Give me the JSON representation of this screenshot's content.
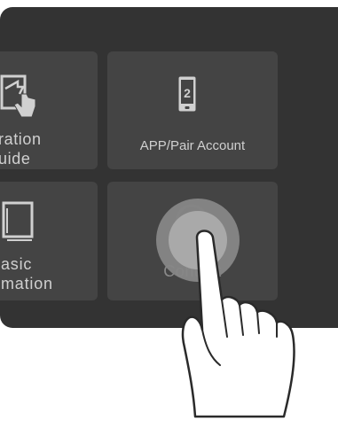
{
  "tiles": [
    {
      "id": "operation-guide",
      "label_lines": [
        "ration",
        "uide"
      ],
      "icon": "tap-guide-icon"
    },
    {
      "id": "app-pair",
      "label": "APP/Pair Account",
      "icon": "phone-icon"
    },
    {
      "id": "basic-info",
      "label_lines": [
        "asic",
        "mation"
      ],
      "icon": "book-icon"
    },
    {
      "id": "contact",
      "label": "Contact",
      "icon": "support-icon"
    }
  ],
  "gesture": {
    "type": "tap",
    "icon": "pointing-hand-icon"
  },
  "colors": {
    "screen_bg": "#333333",
    "tile_bg": "#444444",
    "text": "#d0d0d0",
    "touch_ring": "#878787",
    "touch_core": "#a9a9a9"
  }
}
